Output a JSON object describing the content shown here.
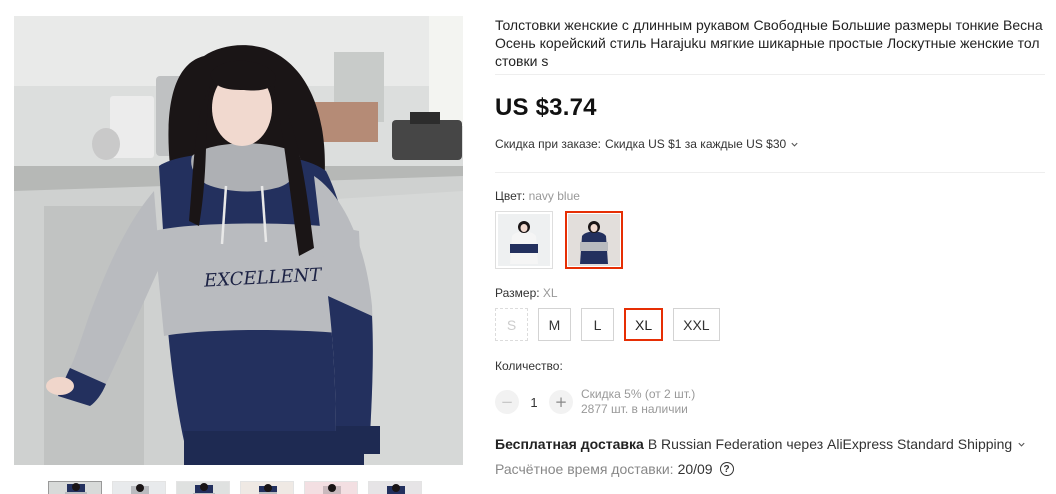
{
  "gallery": {
    "main_image": "woman-in-hoodie-photo",
    "print_text": "EXCELLENT",
    "thumbnails": [
      {
        "name": "thumb-1",
        "active": true
      },
      {
        "name": "thumb-2",
        "active": false
      },
      {
        "name": "thumb-3",
        "active": false
      },
      {
        "name": "thumb-4",
        "active": false
      },
      {
        "name": "thumb-5",
        "active": false
      },
      {
        "name": "thumb-6",
        "active": false
      }
    ]
  },
  "product": {
    "title": "Толстовки женские с длинным рукавом Свободные Большие размеры тонкие Весна Осень корейский стиль Harajuku мягкие шикарные простые Лоскутные женские толстовки s",
    "price": "US $3.74",
    "discount_label": "Скидка при заказе:",
    "discount_value": "Скидка US $1 за каждые US $30"
  },
  "color": {
    "label": "Цвет:",
    "selected_value": "navy blue",
    "swatches": [
      {
        "name": "swatch-1",
        "selected": false
      },
      {
        "name": "swatch-2",
        "selected": true
      }
    ]
  },
  "size": {
    "label": "Размер:",
    "selected_value": "XL",
    "options": [
      {
        "label": "S",
        "state": "disabled"
      },
      {
        "label": "M",
        "state": "normal"
      },
      {
        "label": "L",
        "state": "normal"
      },
      {
        "label": "XL",
        "state": "selected"
      },
      {
        "label": "XXL",
        "state": "normal"
      }
    ]
  },
  "quantity": {
    "label": "Количество:",
    "value": "1",
    "minus": "−",
    "plus": "+",
    "discount_note": "Скидка 5% (от 2 шт.)",
    "stock_note": "2877 шт. в наличии"
  },
  "shipping": {
    "free_label": "Бесплатная доставка",
    "details": "В Russian Federation через AliExpress Standard Shipping",
    "eta_label": "Расчётное время доставки:",
    "eta_date": "20/09",
    "help": "?"
  },
  "colors": {
    "accent": "#e62e04",
    "navy": "#23305e",
    "gray": "#b9bbbf"
  }
}
